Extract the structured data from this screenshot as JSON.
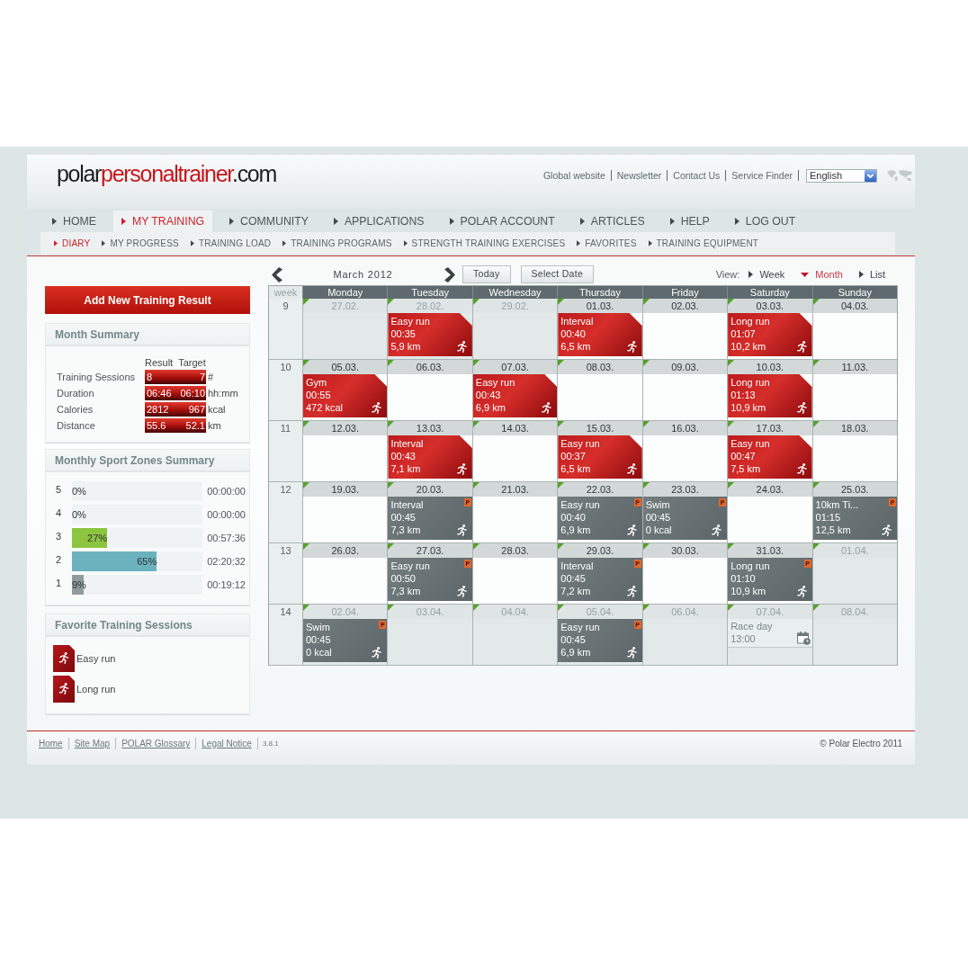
{
  "header": {
    "logo": {
      "prefix": "polar",
      "highlight": "personaltrainer",
      "suffix": ".com"
    },
    "links": [
      "Global website",
      "Newsletter",
      "Contact Us",
      "Service Finder"
    ],
    "language": "English"
  },
  "main_nav": [
    {
      "label": "HOME",
      "selected": false
    },
    {
      "label": "MY TRAINING",
      "selected": true
    },
    {
      "label": "COMMUNITY",
      "selected": false
    },
    {
      "label": "APPLICATIONS",
      "selected": false
    },
    {
      "label": "POLAR ACCOUNT",
      "selected": false
    },
    {
      "label": "ARTICLES",
      "selected": false
    },
    {
      "label": "HELP",
      "selected": false
    },
    {
      "label": "LOG OUT",
      "selected": false
    }
  ],
  "sub_nav": [
    {
      "label": "DIARY",
      "selected": true
    },
    {
      "label": "MY PROGRESS",
      "selected": false
    },
    {
      "label": "TRAINING LOAD",
      "selected": false
    },
    {
      "label": "TRAINING PROGRAMS",
      "selected": false
    },
    {
      "label": "STRENGTH TRAINING EXERCISES",
      "selected": false
    },
    {
      "label": "FAVORITES",
      "selected": false
    },
    {
      "label": "TRAINING EQUIPMENT",
      "selected": false
    }
  ],
  "sidebar": {
    "add_button": "Add New Training Result",
    "month_summary": {
      "title": "Month Summary",
      "columns": [
        "Result",
        "Target"
      ],
      "rows": [
        {
          "label": "Training Sessions",
          "result": "8",
          "target": "7",
          "unit": "#"
        },
        {
          "label": "Duration",
          "result": "06:46",
          "target": "06:10",
          "unit": "hh:mm"
        },
        {
          "label": "Calories",
          "result": "2812",
          "target": "967",
          "unit": "kcal"
        },
        {
          "label": "Distance",
          "result": "55.6",
          "target": "52.1",
          "unit": "km"
        }
      ]
    },
    "sport_zones": {
      "title": "Monthly Sport Zones Summary",
      "zones": [
        {
          "zone": "5",
          "percent": "0%",
          "time": "00:00:00"
        },
        {
          "zone": "4",
          "percent": "0%",
          "time": "00:00:00"
        },
        {
          "zone": "3",
          "percent": "27%",
          "level": 0.27,
          "color": "#8dc440",
          "time": "00:57:36"
        },
        {
          "zone": "2",
          "percent": "65%",
          "level": 0.65,
          "color": "#6cb1be",
          "time": "02:20:32"
        },
        {
          "zone": "1",
          "percent": "9%",
          "level": 0.09,
          "color": "#8f9b9d",
          "time": "00:19:12"
        }
      ]
    },
    "favorites": {
      "title": "Favorite Training Sessions",
      "items": [
        "Easy run",
        "Long run"
      ]
    }
  },
  "calendar": {
    "month_label": "March 2012",
    "buttons": [
      "Today",
      "Select Date"
    ],
    "view_label": "View:",
    "views": [
      {
        "label": "Week",
        "selected": false
      },
      {
        "label": "Month",
        "selected": true
      },
      {
        "label": "List",
        "selected": false
      }
    ],
    "week_column": "week",
    "day_names": [
      "Monday",
      "Tuesday",
      "Wednesday",
      "Thursday",
      "Friday",
      "Saturday",
      "Sunday"
    ],
    "weeks": [
      {
        "number": "9",
        "days": [
          {
            "date": "27.02.",
            "other_month": true
          },
          {
            "date": "28.02.",
            "other_month": true,
            "entry": {
              "kind": "done",
              "title": "Easy run",
              "time": "00:35",
              "detail": "5,9 km"
            }
          },
          {
            "date": "29.02.",
            "other_month": true
          },
          {
            "date": "01.03.",
            "other_month": false,
            "entry": {
              "kind": "done",
              "title": "Interval",
              "time": "00:40",
              "detail": "6,5 km"
            }
          },
          {
            "date": "02.03.",
            "other_month": false
          },
          {
            "date": "03.03.",
            "other_month": false,
            "entry": {
              "kind": "done",
              "title": "Long run",
              "time": "01:07",
              "detail": "10,2 km"
            }
          },
          {
            "date": "04.03.",
            "other_month": false
          }
        ]
      },
      {
        "number": "10",
        "days": [
          {
            "date": "05.03.",
            "other_month": false,
            "entry": {
              "kind": "done",
              "title": "Gym",
              "time": "00:55",
              "detail": "472 kcal"
            }
          },
          {
            "date": "06.03.",
            "other_month": false
          },
          {
            "date": "07.03.",
            "other_month": false,
            "entry": {
              "kind": "done",
              "title": "Easy run",
              "time": "00:43",
              "detail": "6,9 km"
            }
          },
          {
            "date": "08.03.",
            "other_month": false
          },
          {
            "date": "09.03.",
            "other_month": false
          },
          {
            "date": "10.03.",
            "other_month": false,
            "entry": {
              "kind": "done",
              "title": "Long run",
              "time": "01:13",
              "detail": "10,9 km"
            }
          },
          {
            "date": "11.03.",
            "other_month": false
          }
        ]
      },
      {
        "number": "11",
        "days": [
          {
            "date": "12.03.",
            "other_month": false
          },
          {
            "date": "13.03.",
            "other_month": false,
            "entry": {
              "kind": "done",
              "title": "Interval",
              "time": "00:43",
              "detail": "7,1 km"
            }
          },
          {
            "date": "14.03.",
            "other_month": false
          },
          {
            "date": "15.03.",
            "other_month": false,
            "entry": {
              "kind": "done",
              "title": "Easy run",
              "time": "00:37",
              "detail": "6,5 km"
            }
          },
          {
            "date": "16.03.",
            "other_month": false
          },
          {
            "date": "17.03.",
            "other_month": false,
            "entry": {
              "kind": "done",
              "title": "Easy run",
              "time": "00:47",
              "detail": "7,5 km"
            }
          },
          {
            "date": "18.03.",
            "other_month": false
          }
        ]
      },
      {
        "number": "12",
        "days": [
          {
            "date": "19.03.",
            "other_month": false
          },
          {
            "date": "20.03.",
            "other_month": false,
            "entry": {
              "kind": "planned",
              "badge": "P",
              "title": "Interval",
              "time": "00:45",
              "detail": "7,3 km"
            }
          },
          {
            "date": "21.03.",
            "other_month": false
          },
          {
            "date": "22.03.",
            "other_month": false,
            "entry": {
              "kind": "planned",
              "badge": "P",
              "title": "Easy run",
              "time": "00:40",
              "detail": "6,9 km"
            }
          },
          {
            "date": "23.03.",
            "other_month": false,
            "entry": {
              "kind": "planned",
              "badge": "P",
              "title": "Swim",
              "time": "00:45",
              "detail": "0 kcal"
            }
          },
          {
            "date": "24.03.",
            "other_month": false
          },
          {
            "date": "25.03.",
            "other_month": false,
            "entry": {
              "kind": "planned",
              "badge": "P",
              "title": "10km Ti...",
              "time": "01:15",
              "detail": "12,5 km"
            }
          }
        ]
      },
      {
        "number": "13",
        "days": [
          {
            "date": "26.03.",
            "other_month": false
          },
          {
            "date": "27.03.",
            "other_month": false,
            "entry": {
              "kind": "planned",
              "badge": "P",
              "title": "Easy run",
              "time": "00:50",
              "detail": "7,3 km"
            }
          },
          {
            "date": "28.03.",
            "other_month": false
          },
          {
            "date": "29.03.",
            "other_month": false,
            "entry": {
              "kind": "planned",
              "badge": "P",
              "title": "Interval",
              "time": "00:45",
              "detail": "7,2 km"
            }
          },
          {
            "date": "30.03.",
            "other_month": false
          },
          {
            "date": "31.03.",
            "other_month": false,
            "entry": {
              "kind": "planned",
              "badge": "P",
              "title": "Long run",
              "time": "01:10",
              "detail": "10,9 km"
            }
          },
          {
            "date": "01.04.",
            "other_month": true
          }
        ]
      },
      {
        "number": "14",
        "days": [
          {
            "date": "02.04.",
            "other_month": true,
            "entry": {
              "kind": "planned",
              "badge": "P",
              "title": "Swim",
              "time": "00:45",
              "detail": "0 kcal"
            }
          },
          {
            "date": "03.04.",
            "other_month": true
          },
          {
            "date": "04.04.",
            "other_month": true
          },
          {
            "date": "05.04.",
            "other_month": true,
            "entry": {
              "kind": "planned",
              "badge": "P",
              "title": "Easy run",
              "time": "00:45",
              "detail": "6,9 km"
            }
          },
          {
            "date": "06.04.",
            "other_month": true
          },
          {
            "date": "07.04.",
            "other_month": true,
            "entry": {
              "kind": "appointment",
              "title": "Race day",
              "time": "13:00"
            }
          },
          {
            "date": "08.04.",
            "other_month": true
          }
        ]
      }
    ]
  },
  "footer": {
    "links": [
      "Home",
      "Site Map",
      "POLAR Glossary",
      "Legal Notice"
    ],
    "version": "3.8.1",
    "copyright": "© Polar Electro 2011"
  }
}
